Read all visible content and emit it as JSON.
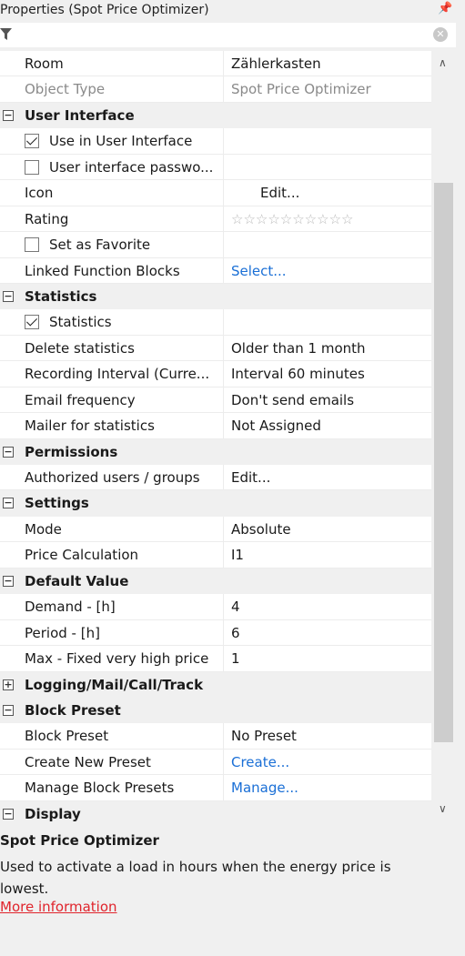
{
  "panel": {
    "title": "Properties (Spot Price Optimizer)",
    "pin_icon": "pin-icon",
    "filter_icon": "filter-icon",
    "clear_icon": "clear-search-icon"
  },
  "rows": {
    "room": {
      "label": "Room",
      "value": "Zählerkasten"
    },
    "object_type": {
      "label": "Object Type",
      "value": "Spot Price Optimizer"
    },
    "ui_cat": {
      "label": "User Interface"
    },
    "use_ui": {
      "label": "Use in User Interface",
      "checked": true
    },
    "ui_password": {
      "label": "User interface passwo...",
      "checked": false
    },
    "icon": {
      "label": "Icon",
      "value": "Edit..."
    },
    "rating": {
      "label": "Rating",
      "value": "☆☆☆☆☆☆☆☆☆☆"
    },
    "favorite": {
      "label": "Set as Favorite",
      "checked": false
    },
    "linked_fb": {
      "label": "Linked Function Blocks",
      "value": "Select..."
    },
    "stats_cat": {
      "label": "Statistics"
    },
    "statistics": {
      "label": "Statistics",
      "checked": true
    },
    "delete_stats": {
      "label": "Delete statistics",
      "value": "Older than 1 month"
    },
    "rec_interval": {
      "label": "Recording Interval (Curre...",
      "value": "Interval 60 minutes"
    },
    "email_freq": {
      "label": "Email frequency",
      "value": "Don't send emails"
    },
    "mailer": {
      "label": "Mailer for statistics",
      "value": "Not Assigned"
    },
    "perm_cat": {
      "label": "Permissions"
    },
    "auth_users": {
      "label": "Authorized users / groups",
      "value": "Edit..."
    },
    "settings_cat": {
      "label": "Settings"
    },
    "mode": {
      "label": "Mode",
      "value": "Absolute"
    },
    "price_calc": {
      "label": "Price Calculation",
      "value": "I1"
    },
    "default_cat": {
      "label": "Default Value"
    },
    "demand": {
      "label": "Demand -  [h]",
      "value": "4"
    },
    "period": {
      "label": "Period -  [h]",
      "value": "6"
    },
    "max_price": {
      "label": "Max - Fixed very high price",
      "value": "1"
    },
    "logging_cat": {
      "label": "Logging/Mail/Call/Track"
    },
    "preset_cat": {
      "label": "Block Preset"
    },
    "block_preset": {
      "label": "Block Preset",
      "value": "No Preset"
    },
    "create_preset": {
      "label": "Create New Preset",
      "value": "Create..."
    },
    "manage_presets": {
      "label": "Manage Block Presets",
      "value": "Manage..."
    },
    "display_cat": {
      "label": "Display"
    }
  },
  "description": {
    "title": "Spot Price Optimizer",
    "text": "Used to activate a load in hours when the energy price is lowest.",
    "link": "More information"
  }
}
